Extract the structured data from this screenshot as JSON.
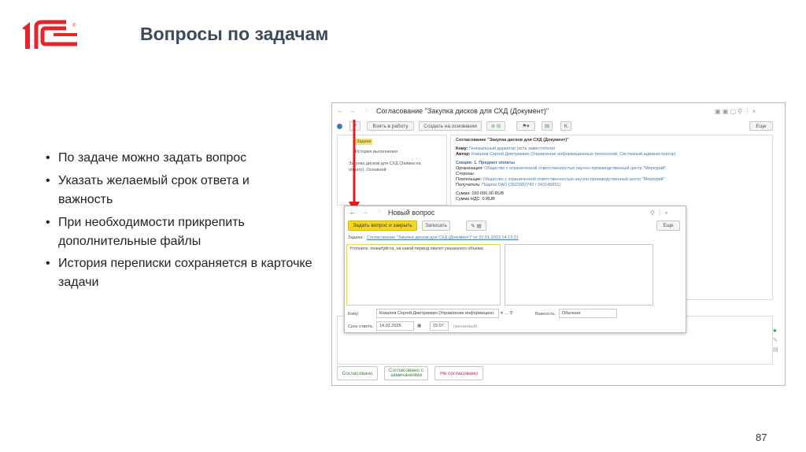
{
  "slide": {
    "title": "Вопросы по задачам",
    "logo_text": "1С",
    "bullets": [
      "По задаче можно задать вопрос",
      "Указать желаемый срок ответа и важность",
      "При необходимости прикрепить дополнительные файлы",
      "История переписки сохраняется в карточке задачи"
    ],
    "page_number": "87"
  },
  "main_window": {
    "title": "Согласование \"Закупка дисков для СХД (Документ)\"",
    "toolbar": {
      "take_to_work": "Взять в работу",
      "create_based_on": "Создать на основании",
      "more": "Еще"
    },
    "tree": {
      "tasks": "Задачи",
      "history": "История выполнения",
      "document": "Закупка дисков для СХД (Заявка на оплату). Основной"
    },
    "detail": {
      "heading": "Согласование \"Закупка дисков для СХД (Документ)\"",
      "to_label": "Кому:",
      "to_value": "Генеральный директор (есть заместители)",
      "author_label": "Автор:",
      "author_value": "Ковалев Сергей Дмитриевич (Управление информационных технологий, Системный администратор)",
      "section": "Секция: 1. Предмет оплаты",
      "org_label": "Организация:",
      "org_value": "Общество с ограниченной ответственностью научно-производственный центр \"Меркурий\"",
      "parties_label": "Стороны:",
      "payer_label": "Плательщик:",
      "payer_value": "Общество с ограниченной ответственностью научно-производственный центр \"Меркурий\"",
      "recipient_label": "Получатель:",
      "recipient_value": "Подиза ОАО (3922682743 / 343145851)",
      "sum": "Сумма: 150 000,00 RUB",
      "vat": "Сумма НДС: 0 RUB"
    },
    "actions": {
      "approved": "Согласовано",
      "approved_remarks": "Согласовано с замечаниями",
      "not_approved": "Не согласовано"
    }
  },
  "dialog": {
    "title": "Новый вопрос",
    "ask_close": "Задать вопрос и закрыть",
    "save": "Записать",
    "more": "Еще",
    "task_label": "Задача:",
    "task_link": "Согласование \"Закупка дисков для СХД (Документ)\" от 22.01.2022 14:13:21",
    "question_text": "Уточните, пожалуйста, на какой период хватит указанного объема",
    "to_label": "Кому:",
    "to_value": "Ковалев Сергей Дмитриевич (Управление информацион",
    "importance_label": "Важность:",
    "importance_value": "Обычная",
    "deadline_label": "Срок ответа:",
    "deadline_date": "14.02.2025",
    "deadline_time": "15:07",
    "deadline_hint": "(желаемый)"
  },
  "colors": {
    "logo_red": "#e3262b",
    "arrow_red": "#e02020",
    "primary_btn": "#f5d628",
    "link": "#4a7aa8",
    "green": "#3a8a3a",
    "red_text": "#c0304a"
  }
}
